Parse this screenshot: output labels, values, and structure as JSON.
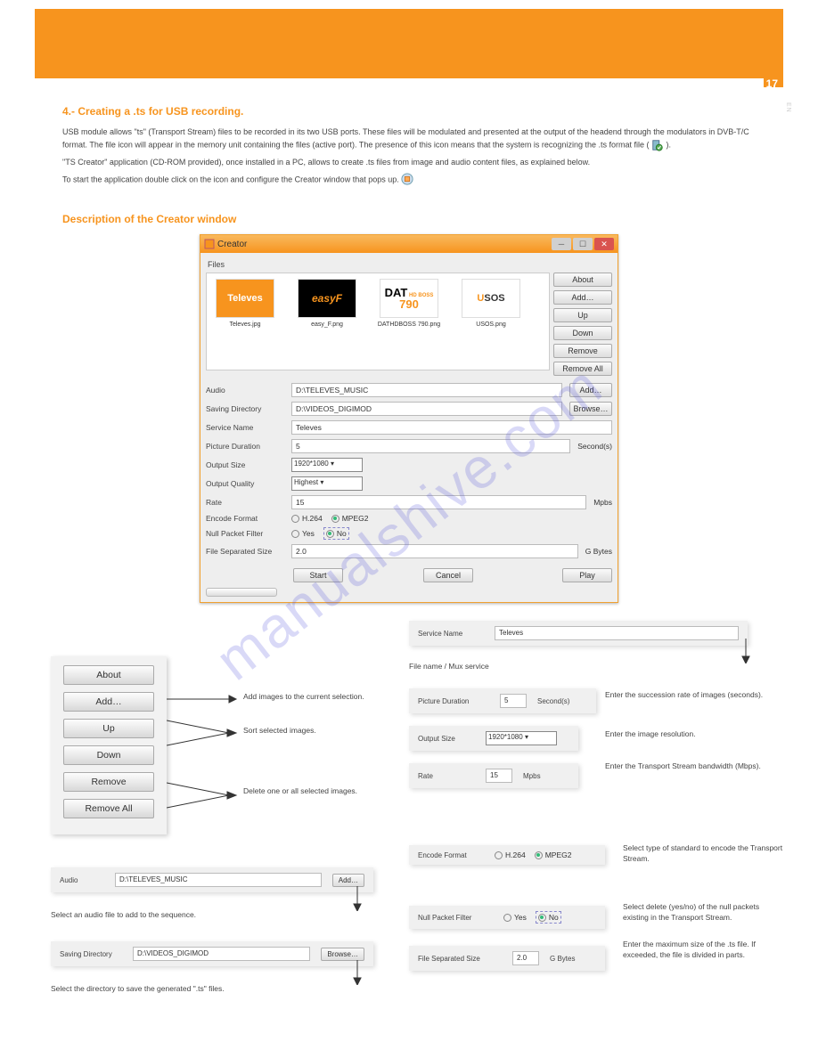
{
  "page_number": "17",
  "side_band": "EN",
  "watermark": "manualshive.com",
  "sections": {
    "title1": "4.- Creating a .ts for USB recording.",
    "para1a": "USB module allows \"ts\" (Transport Stream) files to be recorded in its two USB ports. These files will be modulated and presented at the output of the headend through the modulators in DVB-T/C format. The file icon will appear in the memory unit containing the files (active port). The presence of this icon means that the system is recognizing the .ts format file (",
    "para1b": ").",
    "para2": "\"TS Creator\" application (CD-ROM provided), once installed in a PC, allows to create .ts files from image and audio content files, as explained below.",
    "para3": "To start the application double click on the icon        and configure the Creator window that pops up.",
    "title2": "Description of the Creator window"
  },
  "creator": {
    "title": "Creator",
    "files_label": "Files",
    "thumbs": [
      {
        "logo": "Televes",
        "caption": "Televes.jpg"
      },
      {
        "logo": "easyF",
        "caption": "easy_F.png"
      },
      {
        "logo_top": "DAT HD BOSS",
        "logo_main": "DAT 790",
        "caption": "DATHDBOSS 790.png"
      },
      {
        "logo": "USOS",
        "caption": "USOS.png"
      }
    ],
    "buttons": {
      "about": "About",
      "add": "Add…",
      "up": "Up",
      "down": "Down",
      "remove": "Remove",
      "remove_all": "Remove All"
    },
    "form": {
      "audio_label": "Audio",
      "audio_value": "D:\\TELEVES_MUSIC",
      "audio_btn": "Add…",
      "saving_label": "Saving Directory",
      "saving_value": "D:\\VIDEOS_DIGIMOD",
      "saving_btn": "Browse…",
      "service_label": "Service Name",
      "service_value": "Televes",
      "picdur_label": "Picture Duration",
      "picdur_value": "5",
      "picdur_unit": "Second(s)",
      "outsize_label": "Output Size",
      "outsize_value": "1920*1080",
      "outqual_label": "Output Quality",
      "outqual_value": "Highest",
      "rate_label": "Rate",
      "rate_value": "15",
      "rate_unit": "Mpbs",
      "enc_label": "Encode Format",
      "enc_h264": "H.264",
      "enc_mpeg2": "MPEG2",
      "npf_label": "Null Packet Filter",
      "npf_yes": "Yes",
      "npf_no": "No",
      "fss_label": "File Separated Size",
      "fss_value": "2.0",
      "fss_unit": "G Bytes",
      "start": "Start",
      "cancel": "Cancel",
      "play": "Play"
    }
  },
  "callouts": {
    "add_images": "Add images to the current selection.",
    "up_down": "Sort selected images.",
    "remove": "Delete one or all selected images.",
    "audio": "Select an audio file to add to the sequence.",
    "saving": "Select the directory to save the generated \".ts\" files.",
    "service": "File name / Mux service",
    "picdur": "Enter the succession rate of images (seconds).",
    "outsize": "Enter the image resolution.",
    "rate": "Enter the Transport Stream bandwidth (Mbps).",
    "enc": "Select type of standard to encode the Transport Stream.",
    "npf": "Select delete (yes/no) of the null packets existing in the Transport Stream.",
    "fss": "Enter the maximum size of the .ts file. If exceeded, the file is divided in parts."
  }
}
